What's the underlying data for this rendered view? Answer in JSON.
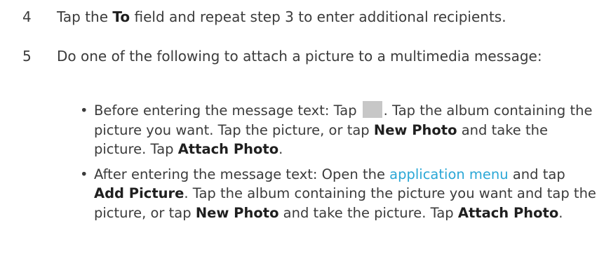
{
  "steps": [
    {
      "number": "4",
      "parts": [
        "Tap the ",
        "To",
        " field and repeat step 3 to enter additional recipients."
      ]
    },
    {
      "number": "5",
      "text": "Do one of the following to attach a picture to a multimedia message:"
    }
  ],
  "bullets": [
    {
      "dot": "•",
      "parts": [
        "Before entering the message text: Tap",
        ". Tap the album containing the picture you want. Tap the picture, or tap ",
        "New Photo",
        " and take the picture. Tap ",
        "Attach Photo",
        "."
      ],
      "icon": "attach-photo-icon"
    },
    {
      "dot": "•",
      "parts": [
        "After entering the message text: Open the ",
        "application menu",
        " and tap ",
        "Add Picture",
        ". Tap the album containing the picture you want and tap the picture, or tap ",
        "New Photo",
        " and take the picture. Tap ",
        "Attach Photo",
        "."
      ]
    }
  ],
  "colors": {
    "text": "#3b3b3b",
    "bold": "#1f1f1f",
    "link": "#2aa7d6",
    "icon_placeholder": "#c7c7c7"
  }
}
